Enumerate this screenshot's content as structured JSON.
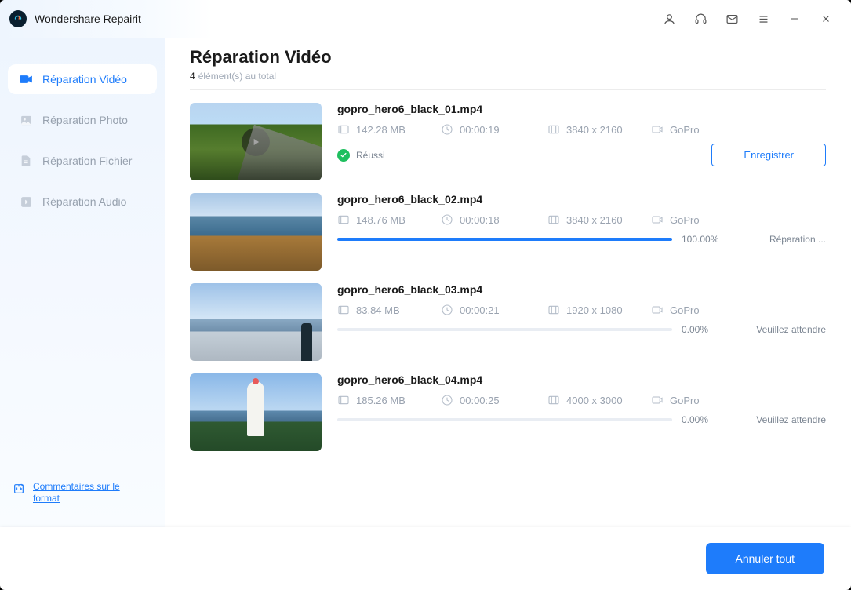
{
  "app": {
    "title": "Wondershare Repairit"
  },
  "sidebar": {
    "items": [
      {
        "label": "Réparation Vidéo",
        "icon": "video"
      },
      {
        "label": "Réparation Photo",
        "icon": "photo"
      },
      {
        "label": "Réparation Fichier",
        "icon": "file"
      },
      {
        "label": "Réparation Audio",
        "icon": "audio"
      }
    ],
    "feedback": "Commentaires sur le format"
  },
  "page": {
    "title": "Réparation Vidéo",
    "count": "4",
    "count_label": "élément(s) au total"
  },
  "buttons": {
    "save": "Enregistrer",
    "cancel_all": "Annuler tout"
  },
  "statuses": {
    "success": "Réussi",
    "repairing": "Réparation ...",
    "waiting": "Veuillez attendre"
  },
  "items": [
    {
      "name": "gopro_hero6_black_01.mp4",
      "size": "142.28  MB",
      "duration": "00:00:19",
      "resolution": "3840 x 2160",
      "device": "GoPro",
      "state": "success"
    },
    {
      "name": "gopro_hero6_black_02.mp4",
      "size": "148.76  MB",
      "duration": "00:00:18",
      "resolution": "3840 x 2160",
      "device": "GoPro",
      "state": "progress",
      "percent": "100.00%",
      "fill": "100%"
    },
    {
      "name": "gopro_hero6_black_03.mp4",
      "size": "83.84  MB",
      "duration": "00:00:21",
      "resolution": "1920 x 1080",
      "device": "GoPro",
      "state": "waiting",
      "percent": "0.00%",
      "fill": "0%"
    },
    {
      "name": "gopro_hero6_black_04.mp4",
      "size": "185.26  MB",
      "duration": "00:00:25",
      "resolution": "4000 x 3000",
      "device": "GoPro",
      "state": "waiting",
      "percent": "0.00%",
      "fill": "0%"
    }
  ]
}
